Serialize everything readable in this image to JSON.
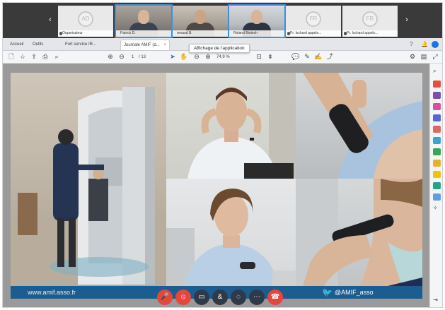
{
  "participants": [
    {
      "type": "avatar",
      "initials": "AD",
      "name": "Organisateur"
    },
    {
      "type": "video",
      "name": "Patrick D.",
      "active": true
    },
    {
      "type": "video",
      "name": "renaud B."
    },
    {
      "type": "video",
      "name": "Roland Biotech",
      "active": true
    },
    {
      "type": "avatar",
      "initials": "FR",
      "name": "Pr. Ischard appels..."
    },
    {
      "type": "avatar",
      "initials": "FR",
      "name": "Pr. Ischard appels..."
    }
  ],
  "browser_tabs": {
    "tab1": "Accueil",
    "tab2": "Outils",
    "tab3": "Fort service IR...",
    "tab4": "Journale AMIF (d...",
    "tab4_close": "×"
  },
  "tooltip": "Affichage de l'application",
  "toolbar": {
    "page_current": "1",
    "page_total": "/ 13",
    "zoom": "74,9 %"
  },
  "banner": {
    "url": "www.amif.asso.fr",
    "handle": "@AMIF_asso"
  },
  "colors": {
    "accent": "#1a73e8",
    "banner": "#1b5d91",
    "end_call": "#e8463a"
  },
  "icons": {
    "strip_prev": "‹",
    "strip_next": "›",
    "twitter": "🐦"
  }
}
